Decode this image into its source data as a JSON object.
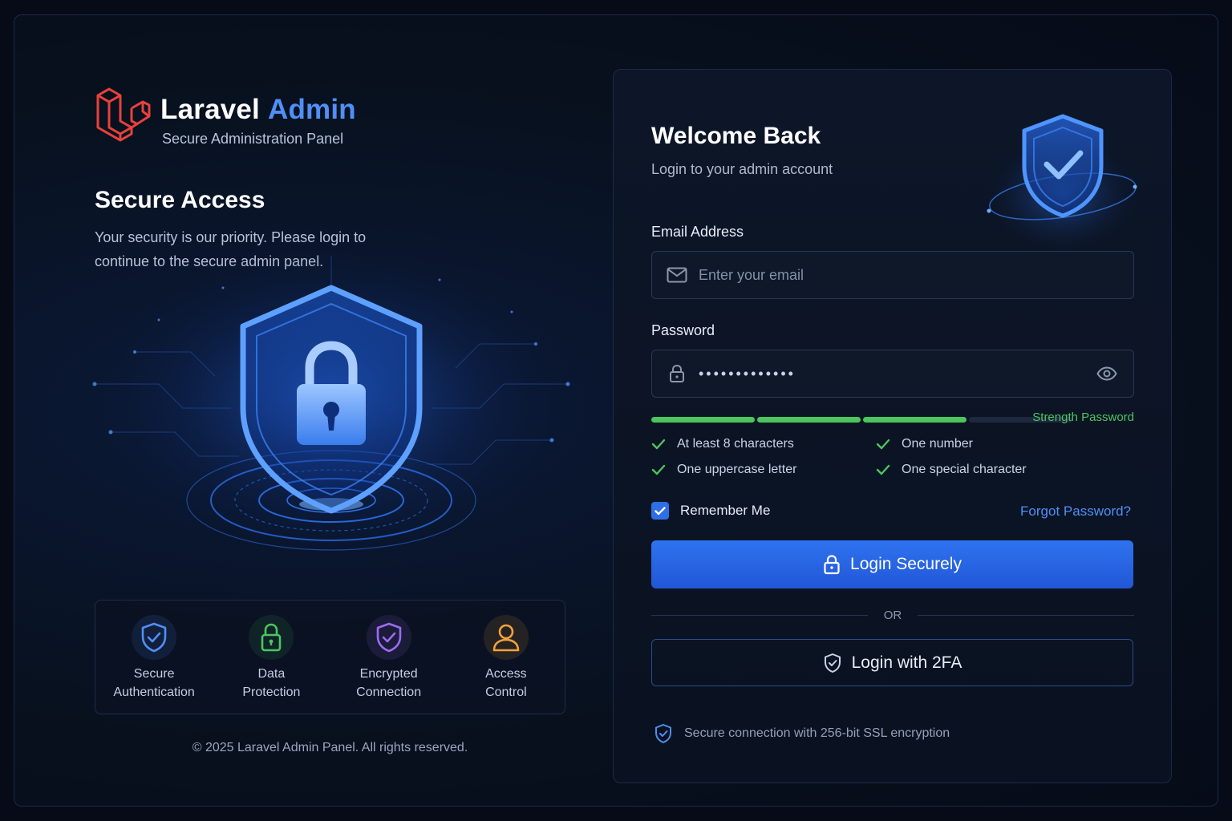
{
  "brand": {
    "name": "Laravel",
    "name_accent": "Admin",
    "subtitle": "Secure Administration Panel"
  },
  "left": {
    "title": "Secure Access",
    "description": "Your security is our priority. Please login to continue to the secure admin panel."
  },
  "features": [
    {
      "label": "Secure\nAuthentication",
      "icon": "shield-check-icon",
      "color": "#4f8ff7"
    },
    {
      "label": "Data\nProtection",
      "icon": "padlock-icon",
      "color": "#4cc55f"
    },
    {
      "label": "Encrypted\nConnection",
      "icon": "shield-check-icon",
      "color": "#9b6cf0"
    },
    {
      "label": "Access\nControl",
      "icon": "user-icon",
      "color": "#f2a23a"
    }
  ],
  "copyright": "© 2025 Laravel Admin Panel. All rights reserved.",
  "login": {
    "title": "Welcome Back",
    "subtitle": "Login to your admin account",
    "email_label": "Email Address",
    "email_placeholder": "Enter your email",
    "email_value": "",
    "password_label": "Password",
    "password_value": "•••••••••••••",
    "strength_label": "Strength Password",
    "strength_filled_segments": 3,
    "strength_total_segments": 4,
    "requirements": [
      {
        "text": "At least 8 characters",
        "met": true
      },
      {
        "text": "One number",
        "met": true
      },
      {
        "text": "One uppercase letter",
        "met": true
      },
      {
        "text": "One special character",
        "met": true
      }
    ],
    "remember_label": "Remember Me",
    "remember_checked": true,
    "forgot_label": "Forgot Password?",
    "login_button": "Login Securely",
    "or_text": "OR",
    "twofa_button": "Login with 2FA",
    "ssl_note": "Secure connection with 256-bit SSL encryption"
  },
  "colors": {
    "accent": "#4f8ff7",
    "success": "#4cc55f",
    "brand_red": "#e8423a",
    "background": "#060b17"
  }
}
